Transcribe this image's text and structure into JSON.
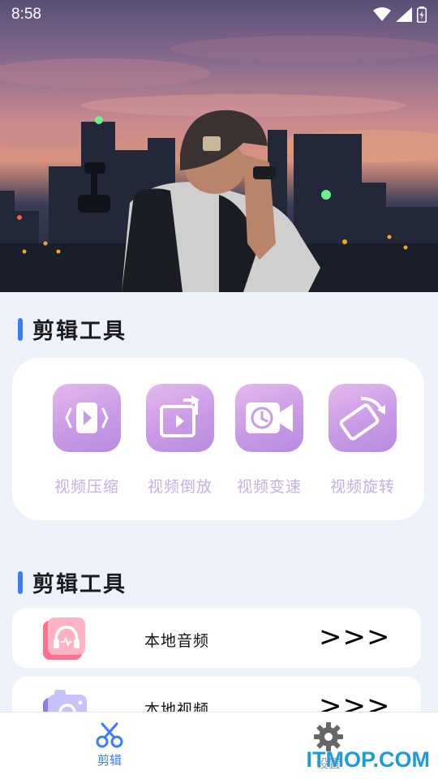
{
  "status_bar": {
    "time": "8:58",
    "icons": [
      "wifi-icon",
      "signal-icon",
      "battery-icon"
    ]
  },
  "hero": {
    "image": "photographer-city-sunset-photo"
  },
  "section1": {
    "title": "剪辑工具"
  },
  "tools": [
    {
      "label": "视频压缩",
      "icon": "video-compress-icon"
    },
    {
      "label": "视频倒放",
      "icon": "video-reverse-icon"
    },
    {
      "label": "视频变速",
      "icon": "video-speed-icon"
    },
    {
      "label": "视频旋转",
      "icon": "video-rotate-icon"
    }
  ],
  "section2": {
    "title": "剪辑工具"
  },
  "list": [
    {
      "label": "本地音频",
      "arrow": ">>>",
      "icon": "local-audio-icon"
    },
    {
      "label": "本地视频",
      "arrow": ">>>",
      "icon": "local-video-camera-icon"
    }
  ],
  "nav": {
    "items": [
      {
        "label": "剪辑",
        "icon": "scissors-icon",
        "active": true
      },
      {
        "label": "设置",
        "icon": "gear-icon",
        "active": false
      }
    ]
  },
  "watermark": "ITMOP.COM",
  "colors": {
    "accent": "#3b7bff",
    "tool_icon": "#c99be6",
    "background": "#eef2fb"
  }
}
